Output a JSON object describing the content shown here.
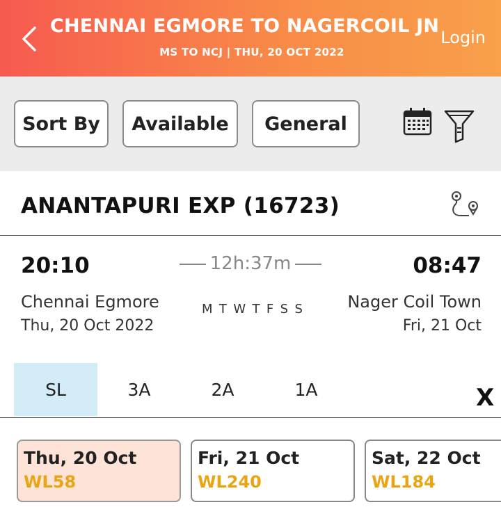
{
  "header": {
    "title": "CHENNAI EGMORE TO NAGERCOIL JN",
    "subtitle": "MS TO NCJ | THU, 20 OCT  2022",
    "login_label": "Login"
  },
  "filters": {
    "sort_label": "Sort By",
    "available_label": "Available",
    "general_label": "General",
    "calendar_icon": "calendar-icon",
    "filter_icon": "funnel-filter-icon"
  },
  "train": {
    "name": "ANANTAPURI EXP (16723)",
    "departure_time": "20:10",
    "arrival_time": "08:47",
    "duration": "12h:37m",
    "from_station": "Chennai Egmore",
    "to_station": "Nager Coil Town",
    "from_date": "Thu, 20 Oct  2022",
    "to_date": "Fri, 21 Oct",
    "days": [
      "M",
      "T",
      "W",
      "T",
      "F",
      "S",
      "S"
    ]
  },
  "classes": [
    "SL",
    "3A",
    "2A",
    "1A"
  ],
  "close_label": "X",
  "availability": [
    {
      "date": "Thu, 20 Oct",
      "status": "WL58"
    },
    {
      "date": "Fri, 21 Oct",
      "status": "WL240"
    },
    {
      "date": "Sat, 22 Oct",
      "status": "WL184"
    }
  ],
  "colors": {
    "header_start": "#f75a50",
    "header_end": "#f9a04a",
    "active_class_bg": "#d4ecf8",
    "selected_date_bg": "#fde3d8",
    "waitlist_text": "#e8a514"
  }
}
